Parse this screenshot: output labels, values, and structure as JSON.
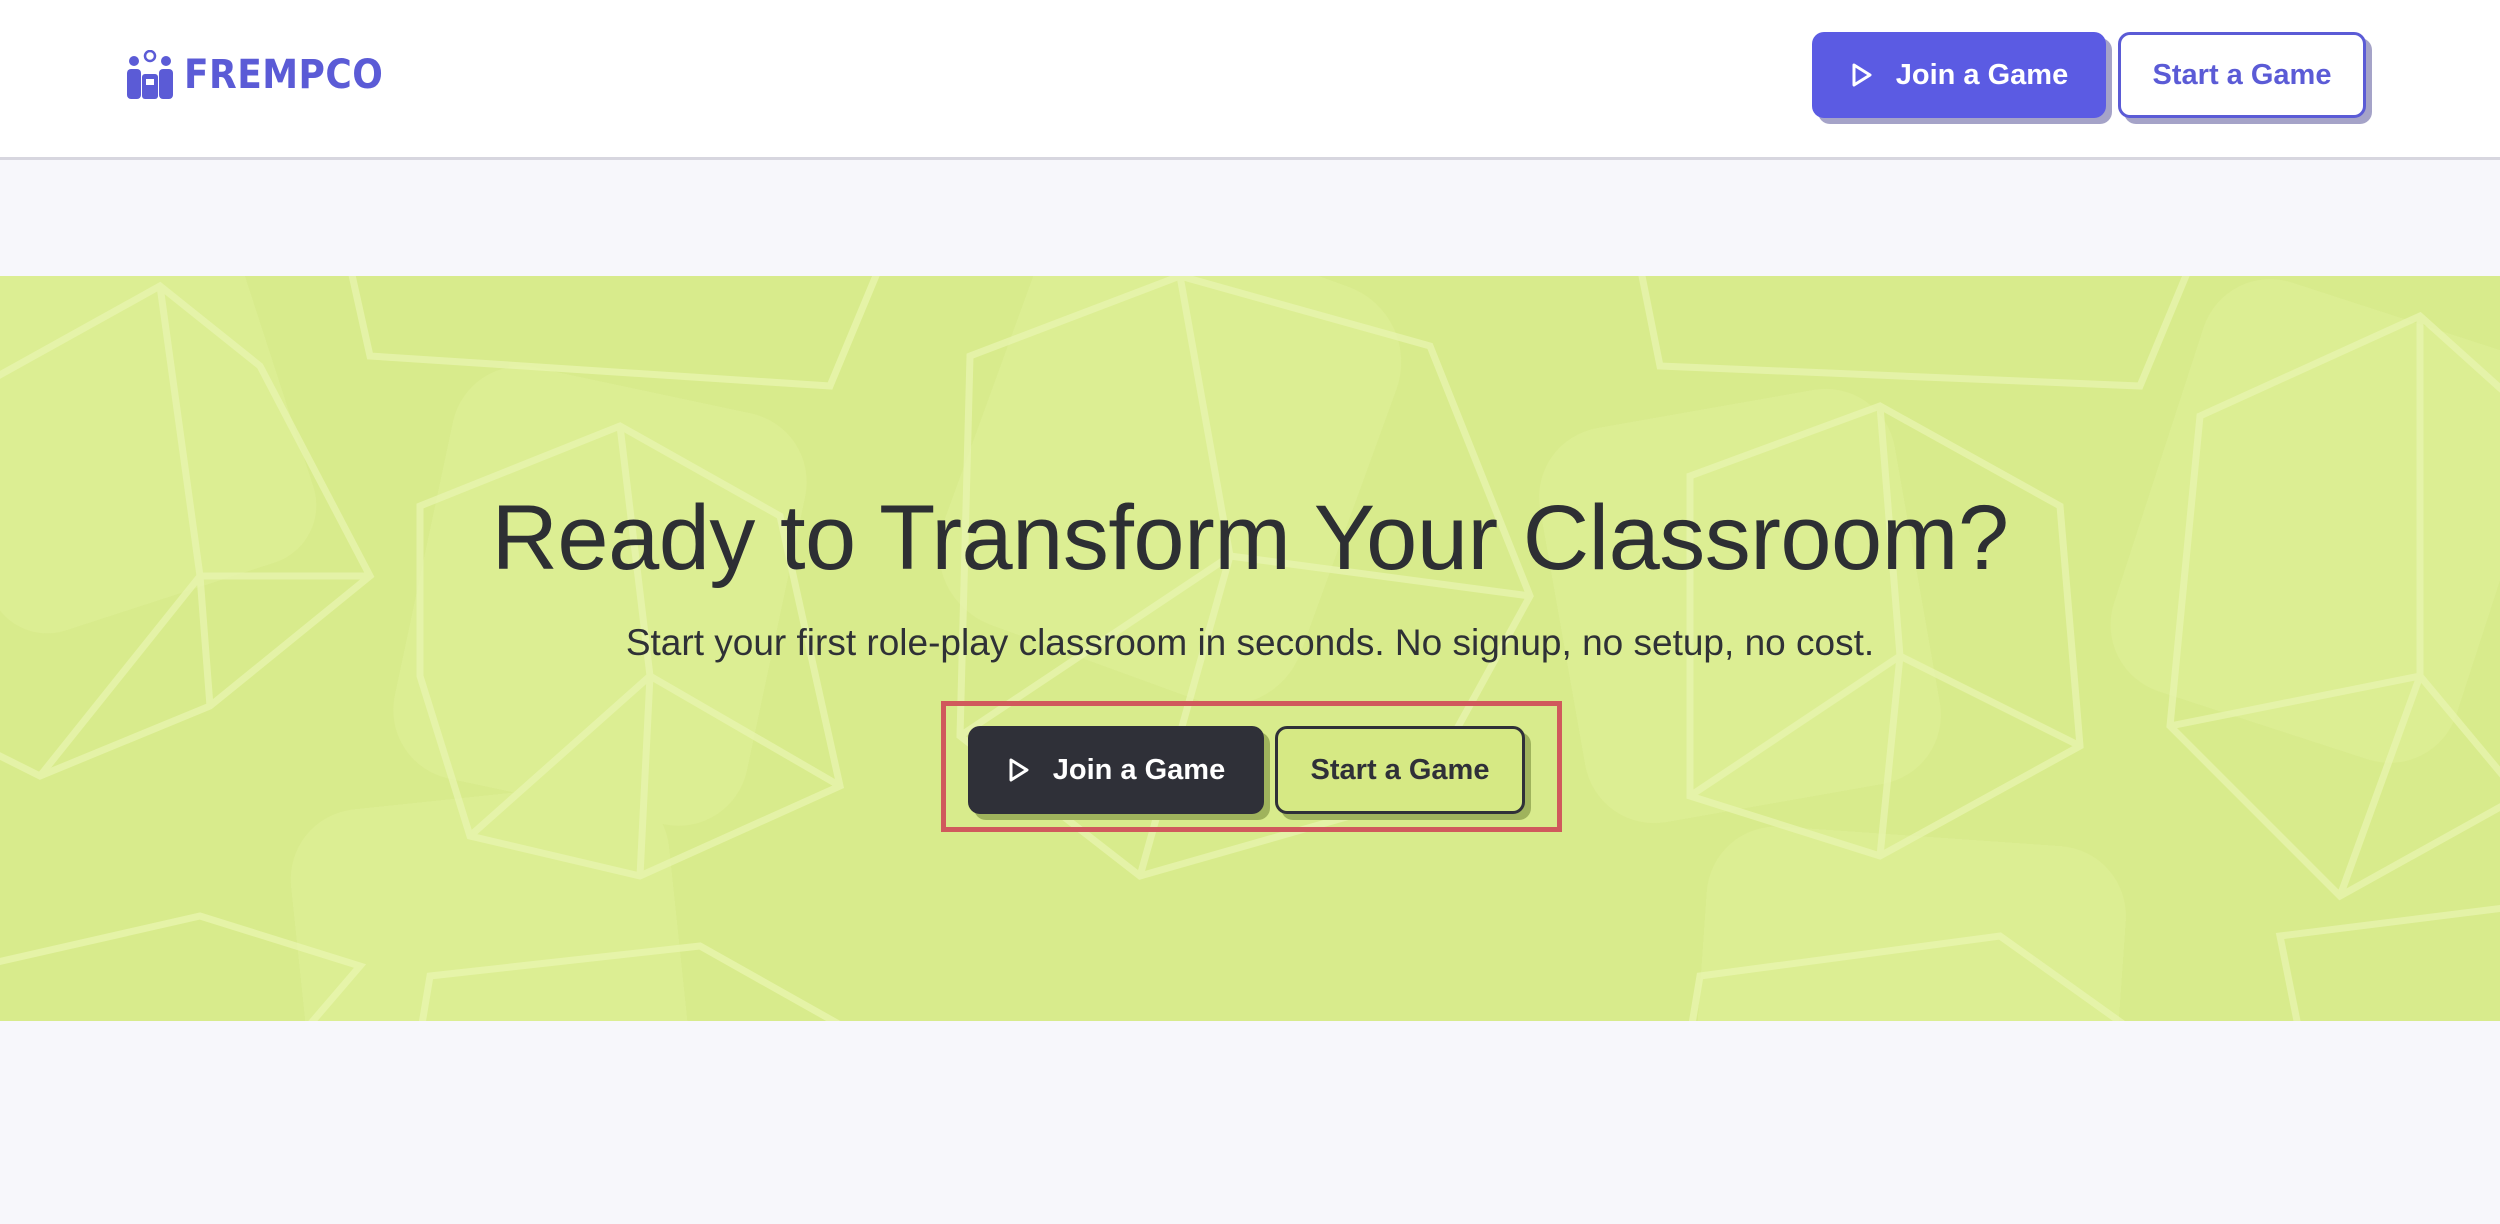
{
  "brand": {
    "name": "FREMPCO",
    "color": "#5b5bd6"
  },
  "header": {
    "join_label": "Join a Game",
    "start_label": "Start a Game"
  },
  "hero": {
    "title": "Ready to Transform Your Classroom?",
    "subtitle": "Start your first role-play classroom in seconds. No signup, no setup, no cost.",
    "join_label": "Join a Game",
    "start_label": "Start a Game",
    "background_color": "#d8eb8c",
    "highlight_color": "#d0595c"
  },
  "icons": {
    "logo": "people-logo-icon",
    "play": "play-icon"
  }
}
